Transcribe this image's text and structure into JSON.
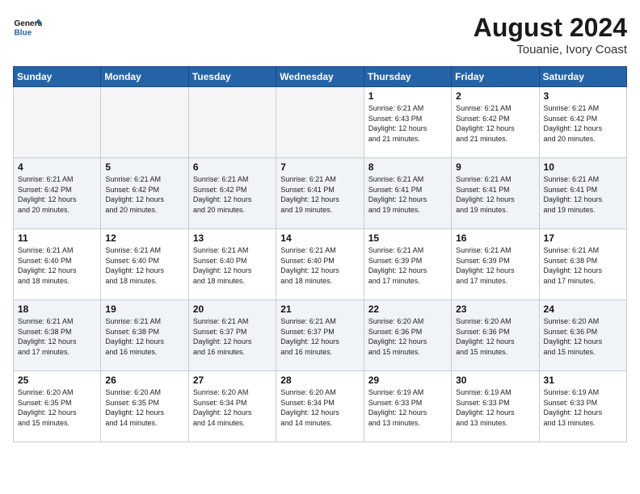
{
  "header": {
    "logo_general": "General",
    "logo_blue": "Blue",
    "month_year": "August 2024",
    "location": "Touanie, Ivory Coast"
  },
  "days_of_week": [
    "Sunday",
    "Monday",
    "Tuesday",
    "Wednesday",
    "Thursday",
    "Friday",
    "Saturday"
  ],
  "weeks": [
    [
      {
        "day": "",
        "info": "",
        "empty": true
      },
      {
        "day": "",
        "info": "",
        "empty": true
      },
      {
        "day": "",
        "info": "",
        "empty": true
      },
      {
        "day": "",
        "info": "",
        "empty": true
      },
      {
        "day": "1",
        "info": "Sunrise: 6:21 AM\nSunset: 6:43 PM\nDaylight: 12 hours\nand 21 minutes."
      },
      {
        "day": "2",
        "info": "Sunrise: 6:21 AM\nSunset: 6:42 PM\nDaylight: 12 hours\nand 21 minutes."
      },
      {
        "day": "3",
        "info": "Sunrise: 6:21 AM\nSunset: 6:42 PM\nDaylight: 12 hours\nand 20 minutes."
      }
    ],
    [
      {
        "day": "4",
        "info": "Sunrise: 6:21 AM\nSunset: 6:42 PM\nDaylight: 12 hours\nand 20 minutes."
      },
      {
        "day": "5",
        "info": "Sunrise: 6:21 AM\nSunset: 6:42 PM\nDaylight: 12 hours\nand 20 minutes."
      },
      {
        "day": "6",
        "info": "Sunrise: 6:21 AM\nSunset: 6:42 PM\nDaylight: 12 hours\nand 20 minutes."
      },
      {
        "day": "7",
        "info": "Sunrise: 6:21 AM\nSunset: 6:41 PM\nDaylight: 12 hours\nand 19 minutes."
      },
      {
        "day": "8",
        "info": "Sunrise: 6:21 AM\nSunset: 6:41 PM\nDaylight: 12 hours\nand 19 minutes."
      },
      {
        "day": "9",
        "info": "Sunrise: 6:21 AM\nSunset: 6:41 PM\nDaylight: 12 hours\nand 19 minutes."
      },
      {
        "day": "10",
        "info": "Sunrise: 6:21 AM\nSunset: 6:41 PM\nDaylight: 12 hours\nand 19 minutes."
      }
    ],
    [
      {
        "day": "11",
        "info": "Sunrise: 6:21 AM\nSunset: 6:40 PM\nDaylight: 12 hours\nand 18 minutes."
      },
      {
        "day": "12",
        "info": "Sunrise: 6:21 AM\nSunset: 6:40 PM\nDaylight: 12 hours\nand 18 minutes."
      },
      {
        "day": "13",
        "info": "Sunrise: 6:21 AM\nSunset: 6:40 PM\nDaylight: 12 hours\nand 18 minutes."
      },
      {
        "day": "14",
        "info": "Sunrise: 6:21 AM\nSunset: 6:40 PM\nDaylight: 12 hours\nand 18 minutes."
      },
      {
        "day": "15",
        "info": "Sunrise: 6:21 AM\nSunset: 6:39 PM\nDaylight: 12 hours\nand 17 minutes."
      },
      {
        "day": "16",
        "info": "Sunrise: 6:21 AM\nSunset: 6:39 PM\nDaylight: 12 hours\nand 17 minutes."
      },
      {
        "day": "17",
        "info": "Sunrise: 6:21 AM\nSunset: 6:38 PM\nDaylight: 12 hours\nand 17 minutes."
      }
    ],
    [
      {
        "day": "18",
        "info": "Sunrise: 6:21 AM\nSunset: 6:38 PM\nDaylight: 12 hours\nand 17 minutes."
      },
      {
        "day": "19",
        "info": "Sunrise: 6:21 AM\nSunset: 6:38 PM\nDaylight: 12 hours\nand 16 minutes."
      },
      {
        "day": "20",
        "info": "Sunrise: 6:21 AM\nSunset: 6:37 PM\nDaylight: 12 hours\nand 16 minutes."
      },
      {
        "day": "21",
        "info": "Sunrise: 6:21 AM\nSunset: 6:37 PM\nDaylight: 12 hours\nand 16 minutes."
      },
      {
        "day": "22",
        "info": "Sunrise: 6:20 AM\nSunset: 6:36 PM\nDaylight: 12 hours\nand 15 minutes."
      },
      {
        "day": "23",
        "info": "Sunrise: 6:20 AM\nSunset: 6:36 PM\nDaylight: 12 hours\nand 15 minutes."
      },
      {
        "day": "24",
        "info": "Sunrise: 6:20 AM\nSunset: 6:36 PM\nDaylight: 12 hours\nand 15 minutes."
      }
    ],
    [
      {
        "day": "25",
        "info": "Sunrise: 6:20 AM\nSunset: 6:35 PM\nDaylight: 12 hours\nand 15 minutes."
      },
      {
        "day": "26",
        "info": "Sunrise: 6:20 AM\nSunset: 6:35 PM\nDaylight: 12 hours\nand 14 minutes."
      },
      {
        "day": "27",
        "info": "Sunrise: 6:20 AM\nSunset: 6:34 PM\nDaylight: 12 hours\nand 14 minutes."
      },
      {
        "day": "28",
        "info": "Sunrise: 6:20 AM\nSunset: 6:34 PM\nDaylight: 12 hours\nand 14 minutes."
      },
      {
        "day": "29",
        "info": "Sunrise: 6:19 AM\nSunset: 6:33 PM\nDaylight: 12 hours\nand 13 minutes."
      },
      {
        "day": "30",
        "info": "Sunrise: 6:19 AM\nSunset: 6:33 PM\nDaylight: 12 hours\nand 13 minutes."
      },
      {
        "day": "31",
        "info": "Sunrise: 6:19 AM\nSunset: 6:33 PM\nDaylight: 12 hours\nand 13 minutes."
      }
    ]
  ]
}
